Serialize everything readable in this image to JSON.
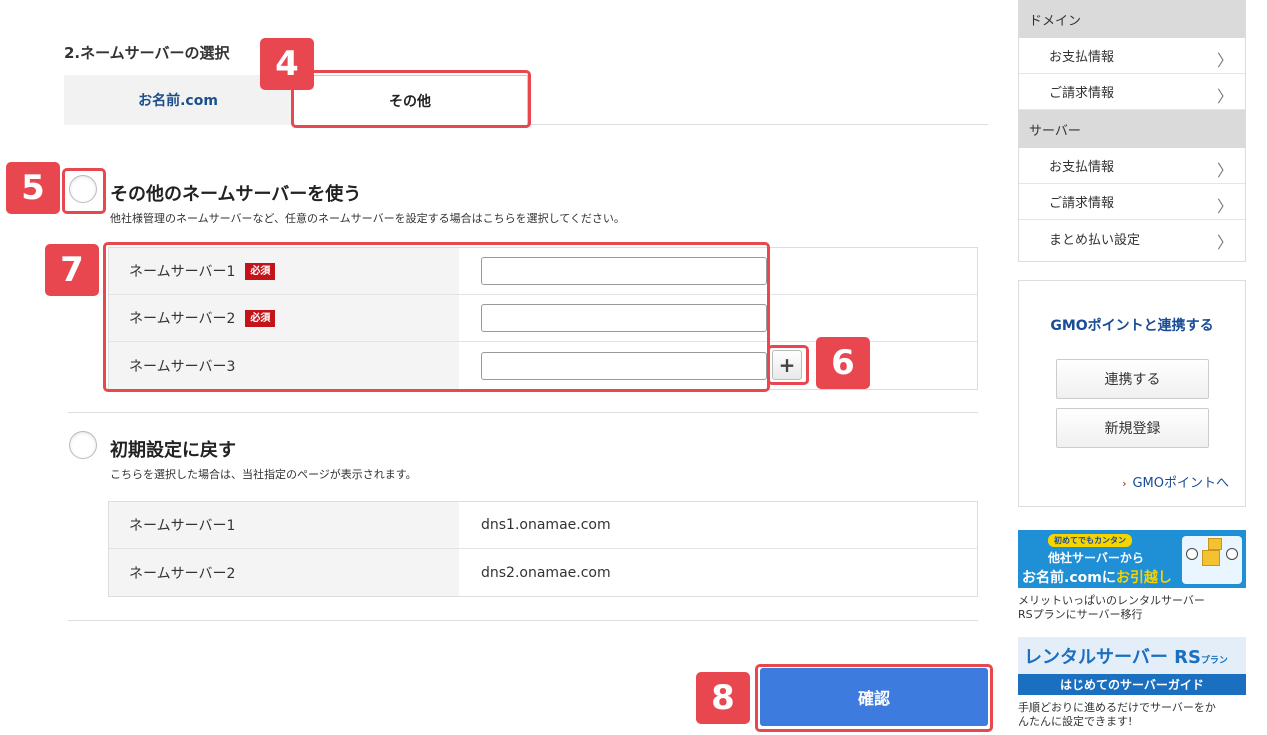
{
  "section_title": "2.ネームサーバーの選択",
  "tabs": [
    {
      "label": "お名前.com"
    },
    {
      "label": "その他"
    }
  ],
  "option_other": {
    "title": "その他のネームサーバーを使う",
    "description": "他社様管理のネームサーバーなど、任意のネームサーバーを設定する場合はこちらを選択してください。",
    "required_badge": "必須",
    "rows": [
      {
        "label": "ネームサーバー1",
        "value": ""
      },
      {
        "label": "ネームサーバー2",
        "value": ""
      },
      {
        "label": "ネームサーバー3",
        "value": ""
      }
    ],
    "add_label": "+"
  },
  "option_default": {
    "title": "初期設定に戻す",
    "description": "こちらを選択した場合は、当社指定のページが表示されます。",
    "rows": [
      {
        "label": "ネームサーバー1",
        "value": "dns1.onamae.com"
      },
      {
        "label": "ネームサーバー2",
        "value": "dns2.onamae.com"
      }
    ]
  },
  "confirm_label": "確認",
  "steps": {
    "s4": "4",
    "s5": "5",
    "s6": "6",
    "s7": "7",
    "s8": "8"
  },
  "sidebar": {
    "groups": [
      {
        "heading": "ドメイン",
        "items": [
          {
            "label": "お支払情報"
          },
          {
            "label": "ご請求情報"
          }
        ]
      },
      {
        "heading": "サーバー",
        "items": [
          {
            "label": "お支払情報"
          },
          {
            "label": "ご請求情報"
          },
          {
            "label": "まとめ払い設定"
          }
        ]
      }
    ],
    "chevron": "〉"
  },
  "gmo": {
    "title": "GMOポイントと連携する",
    "link_button": "連携する",
    "register_button": "新規登録",
    "points_link": "GMOポイントへ",
    "arrow": "›"
  },
  "banner1": {
    "tag": "初めてでもカンタン",
    "line1": "他社サーバーから",
    "line2a": "お名前.comに",
    "line2b": "お引越し",
    "caption1": "メリットいっぱいのレンタルサーバー",
    "caption2": "RSプランにサーバー移行"
  },
  "banner2": {
    "line1": "レンタルサーバー RS",
    "line1_small": "プラン",
    "bar": "はじめてのサーバーガイド",
    "caption1": "手順どおりに進めるだけでサーバーをか",
    "caption2": "んたんに設定できます!"
  },
  "colors": {
    "accent_red": "#e8474f",
    "confirm_blue": "#3d7cde",
    "link_blue": "#1a4c97",
    "required_red": "#c3141b"
  }
}
